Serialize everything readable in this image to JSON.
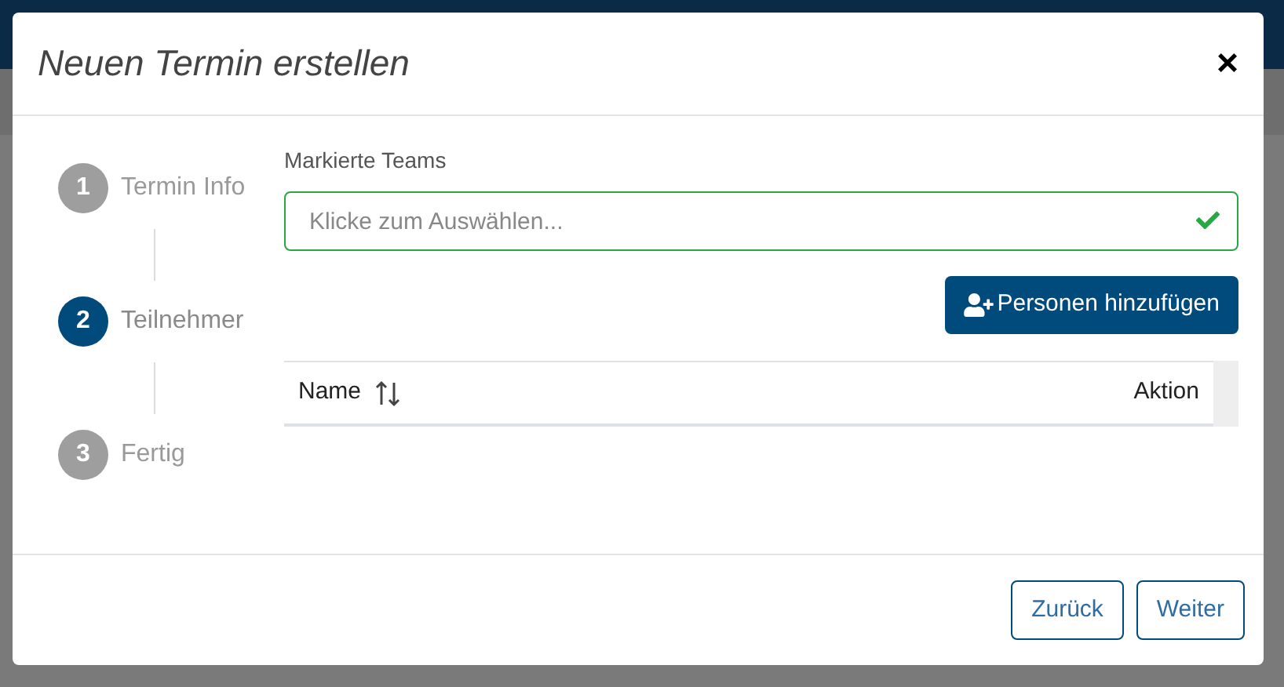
{
  "dialog": {
    "title": "Neuen Termin erstellen",
    "close": "×"
  },
  "steps": [
    {
      "number": "1",
      "label": "Termin Info",
      "selected": false
    },
    {
      "number": "2",
      "label": "Teilnehmer",
      "selected": true
    },
    {
      "number": "3",
      "label": "Fertig",
      "selected": false
    }
  ],
  "teams_field": {
    "label": "Markierte Teams",
    "placeholder": "Klicke zum Auswählen...",
    "valid": true
  },
  "add_button": "Personen hinzufügen",
  "table": {
    "columns": [
      {
        "label": "Name",
        "sortable": true
      },
      {
        "label": "Aktion",
        "sortable": false
      }
    ]
  },
  "footer_buttons": [
    "Zurück",
    "Weiter"
  ]
}
